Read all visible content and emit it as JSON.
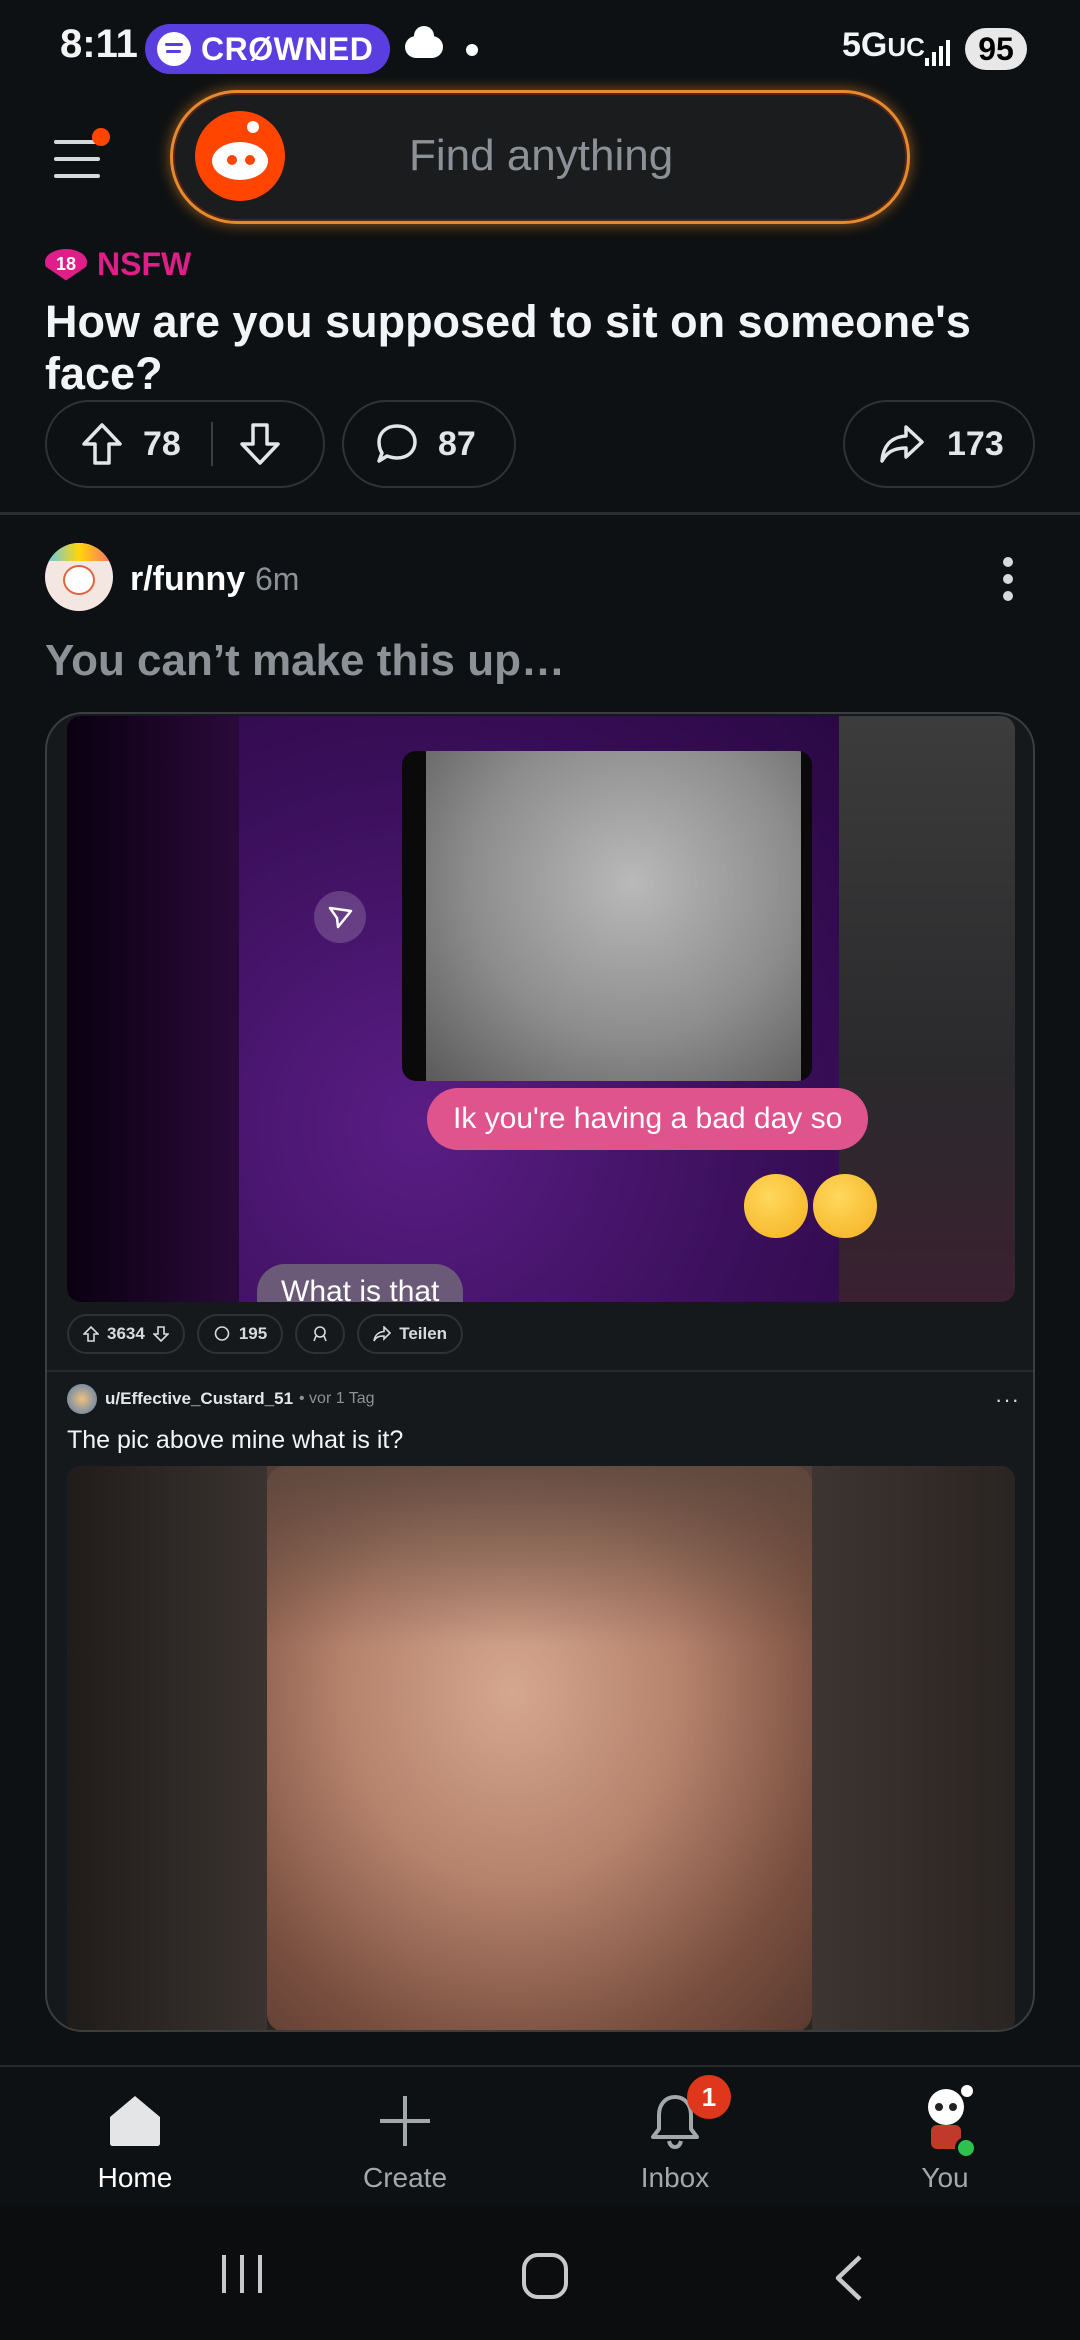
{
  "status_bar": {
    "time": "8:11",
    "spotify_label": "CRØWNED",
    "network_main": "5G",
    "network_sub": "UC",
    "battery": "95"
  },
  "header": {
    "search_placeholder": "Find anything"
  },
  "previous_post": {
    "nsfw_badge": "18",
    "nsfw_label": "NSFW",
    "title": "How are you supposed to sit on someone's face?",
    "upvotes": "78",
    "comments": "87",
    "shares": "173"
  },
  "post": {
    "subreddit": "r/funny",
    "time": "6m",
    "title": "You can’t make this up…",
    "image1": {
      "bubble_pink": "Ik you're having a bad day so",
      "bubble_grey": "What is that"
    },
    "inner_actions": {
      "votes": "3634",
      "comments": "195",
      "share": "Teilen"
    },
    "embed": {
      "user": "u/Effective_Custard_51",
      "time": "• vor 1 Tag",
      "more": "···",
      "title": "The pic above mine what is it?"
    }
  },
  "bottom_nav": {
    "home": "Home",
    "create": "Create",
    "inbox": "Inbox",
    "inbox_badge": "1",
    "you": "You"
  },
  "colors": {
    "background": "#0e1113",
    "accent": "#ff4500",
    "nsfw": "#e01e8a",
    "spotify_pill": "#5b3ee0"
  }
}
